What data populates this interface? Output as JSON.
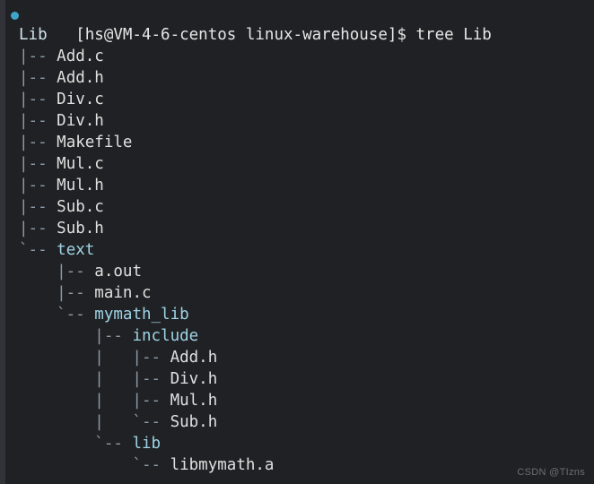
{
  "terminal": {
    "prompt": "[hs@VM-4-6-centos linux-warehouse]$ ",
    "command": "tree Lib",
    "root": "Lib",
    "colors": {
      "background": "#202124",
      "gutter": "#323338",
      "text": "#dcdcdc",
      "branch": "#8a9aa8",
      "directory": "#9fd4e6",
      "file": "#e0e0e0",
      "prompt_dot": "#3ea6c8",
      "watermark": "#6e6e72"
    },
    "prompt_dot_icon": "status-dot-icon",
    "lines": [
      {
        "branch": "",
        "name": "Lib",
        "kind": "root"
      },
      {
        "branch": "|-- ",
        "name": "Add.c",
        "kind": "file"
      },
      {
        "branch": "|-- ",
        "name": "Add.h",
        "kind": "file"
      },
      {
        "branch": "|-- ",
        "name": "Div.c",
        "kind": "file"
      },
      {
        "branch": "|-- ",
        "name": "Div.h",
        "kind": "file"
      },
      {
        "branch": "|-- ",
        "name": "Makefile",
        "kind": "file"
      },
      {
        "branch": "|-- ",
        "name": "Mul.c",
        "kind": "file"
      },
      {
        "branch": "|-- ",
        "name": "Mul.h",
        "kind": "file"
      },
      {
        "branch": "|-- ",
        "name": "Sub.c",
        "kind": "file"
      },
      {
        "branch": "|-- ",
        "name": "Sub.h",
        "kind": "file"
      },
      {
        "branch": "`-- ",
        "name": "text",
        "kind": "dir"
      },
      {
        "branch": "    |-- ",
        "name": "a.out",
        "kind": "file"
      },
      {
        "branch": "    |-- ",
        "name": "main.c",
        "kind": "file"
      },
      {
        "branch": "    `-- ",
        "name": "mymath_lib",
        "kind": "dir"
      },
      {
        "branch": "        |-- ",
        "name": "include",
        "kind": "dir"
      },
      {
        "branch": "        |   |-- ",
        "name": "Add.h",
        "kind": "file"
      },
      {
        "branch": "        |   |-- ",
        "name": "Div.h",
        "kind": "file"
      },
      {
        "branch": "        |   |-- ",
        "name": "Mul.h",
        "kind": "file"
      },
      {
        "branch": "        |   `-- ",
        "name": "Sub.h",
        "kind": "file"
      },
      {
        "branch": "        `-- ",
        "name": "lib",
        "kind": "dir"
      },
      {
        "branch": "            `-- ",
        "name": "libmymath.a",
        "kind": "file"
      }
    ]
  },
  "watermark": {
    "text": "CSDN @TIzns"
  }
}
